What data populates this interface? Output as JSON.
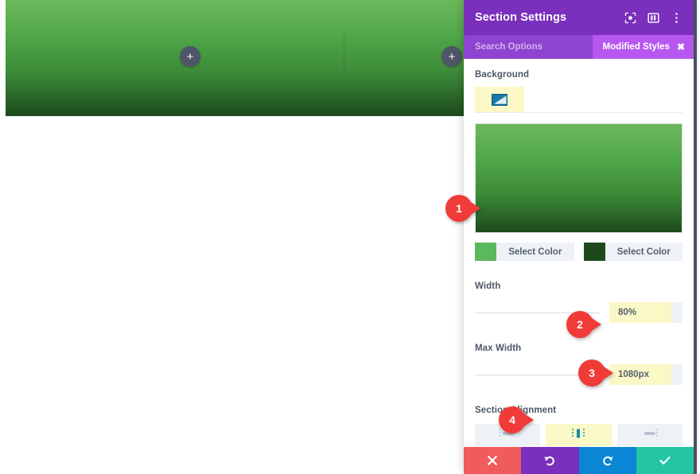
{
  "canvas": {
    "add_button_label": "+",
    "section_gradient_top": "#6cb85c",
    "section_gradient_bottom": "#1d4a1d"
  },
  "panel": {
    "title": "Section Settings",
    "header_icons": [
      {
        "name": "focus-icon",
        "label": "Focus"
      },
      {
        "name": "layout-icon",
        "label": "Layout"
      },
      {
        "name": "more-options-icon",
        "label": "More"
      }
    ],
    "search": {
      "placeholder": "Search Options",
      "value": ""
    },
    "modified_badge": {
      "label": "Modified Styles",
      "close_label": "✖"
    },
    "accent_purple": "#7a2fbd",
    "accent_purple_light": "#8e44d0",
    "badge_purple": "#b657f0",
    "highlight_yellow": "#fbf8c8"
  },
  "background": {
    "label": "Background",
    "active_tab": "gradient",
    "gradient_preview": {
      "start_color": "#6cb85c",
      "end_color": "#1d4a1d"
    },
    "color_stops": [
      {
        "swatch": "#5cb85c",
        "button_label": "Select Color"
      },
      {
        "swatch": "#1d4a1d",
        "button_label": "Select Color"
      }
    ]
  },
  "width": {
    "label": "Width",
    "value": "80%",
    "slider_percent": 0
  },
  "max_width": {
    "label": "Max Width",
    "value": "1080px",
    "slider_percent": 0
  },
  "section_alignment": {
    "label": "Section Alignment",
    "options": [
      {
        "name": "align-left",
        "selected": false
      },
      {
        "name": "align-center",
        "selected": true
      },
      {
        "name": "align-right",
        "selected": false
      }
    ]
  },
  "footer": {
    "buttons": [
      {
        "name": "cancel-button",
        "icon": "close-icon",
        "color": "#f05b5b"
      },
      {
        "name": "undo-button",
        "icon": "undo-icon",
        "color": "#7a2fbd"
      },
      {
        "name": "redo-button",
        "icon": "redo-icon",
        "color": "#0b86d4"
      },
      {
        "name": "save-button",
        "icon": "checkmark-icon",
        "color": "#23c5a4"
      }
    ]
  },
  "callouts": [
    {
      "number": "1"
    },
    {
      "number": "2"
    },
    {
      "number": "3"
    },
    {
      "number": "4"
    }
  ]
}
